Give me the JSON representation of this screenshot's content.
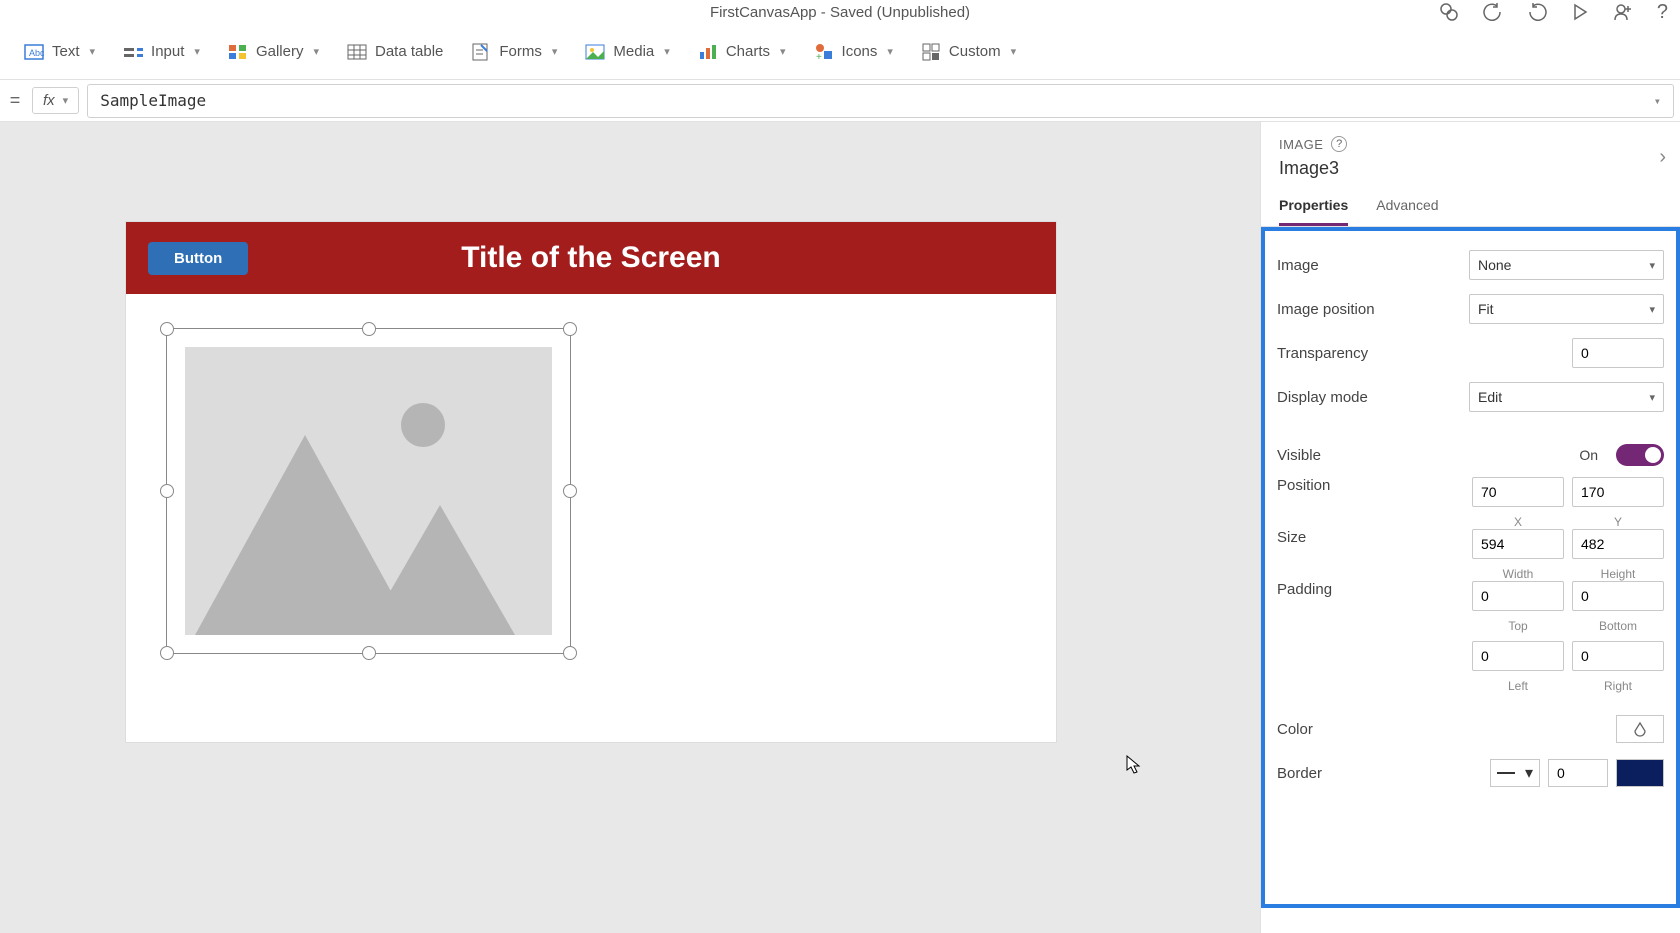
{
  "titlebar": {
    "text": "FirstCanvasApp - Saved (Unpublished)"
  },
  "ribbon": {
    "items": [
      {
        "label": "Text"
      },
      {
        "label": "Input"
      },
      {
        "label": "Gallery"
      },
      {
        "label": "Data table"
      },
      {
        "label": "Forms"
      },
      {
        "label": "Media"
      },
      {
        "label": "Charts"
      },
      {
        "label": "Icons"
      },
      {
        "label": "Custom"
      }
    ]
  },
  "formulabar": {
    "value": "SampleImage"
  },
  "canvas": {
    "button_label": "Button",
    "title": "Title of the Screen"
  },
  "panel": {
    "type_label": "IMAGE",
    "control_name": "Image3",
    "tabs": {
      "properties": "Properties",
      "advanced": "Advanced"
    },
    "props": {
      "image": {
        "label": "Image",
        "value": "None"
      },
      "image_position": {
        "label": "Image position",
        "value": "Fit"
      },
      "transparency": {
        "label": "Transparency",
        "value": "0"
      },
      "display_mode": {
        "label": "Display mode",
        "value": "Edit"
      },
      "visible": {
        "label": "Visible",
        "state": "On"
      },
      "position": {
        "label": "Position",
        "x": "70",
        "y": "170",
        "xcap": "X",
        "ycap": "Y"
      },
      "size": {
        "label": "Size",
        "w": "594",
        "h": "482",
        "wcap": "Width",
        "hcap": "Height"
      },
      "padding": {
        "label": "Padding",
        "top": "0",
        "bottom": "0",
        "left": "0",
        "right": "0",
        "topcap": "Top",
        "bottomcap": "Bottom",
        "leftcap": "Left",
        "rightcap": "Right"
      },
      "color": {
        "label": "Color"
      },
      "border": {
        "label": "Border",
        "width": "0",
        "color": "#0b1e5e"
      }
    }
  }
}
